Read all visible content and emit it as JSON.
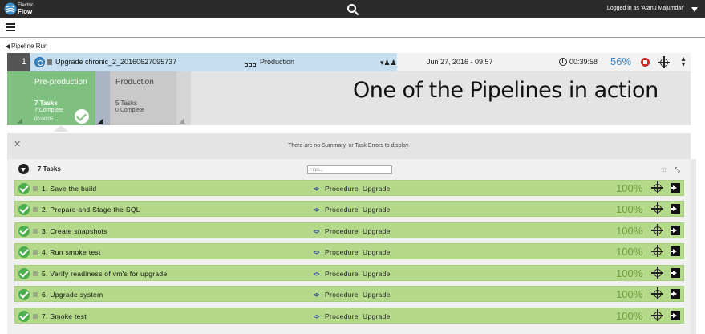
{
  "brand": {
    "line1": "Electric",
    "line2": "Flow",
    "logo_icon": "electricflow-logo-icon"
  },
  "header": {
    "search_icon": "search-icon",
    "login_text": "Logged in as 'Atanu Majumdar'"
  },
  "breadcrumb": {
    "label": "Pipeline Run"
  },
  "run": {
    "number": "1",
    "name": "Upgrade chronic_2_20160627095737",
    "environment": "Production",
    "date": "Jun 27, 2016 - 09:57",
    "elapsed": "00:39:58",
    "progress": "56%"
  },
  "stages": [
    {
      "name": "Pre-production",
      "tasks": "7 Tasks",
      "complete": "7 Complete",
      "time": "00:00:05",
      "status": "success"
    },
    {
      "name": "Production",
      "tasks": "5 Tasks",
      "complete": "0 Complete"
    }
  ],
  "annotation": "One of the Pipelines in action",
  "summary": {
    "message": "There are no Summary, or Task Errors to display."
  },
  "tasks_panel": {
    "count_label": "7 Tasks",
    "find_placeholder": "Find..."
  },
  "tasks": [
    {
      "name": "1. Save the build",
      "type": "Procedure",
      "procedure": "Upgrade",
      "progress": "100%"
    },
    {
      "name": "2. Prepare and Stage the SQL",
      "type": "Procedure",
      "procedure": "Upgrade",
      "progress": "100%"
    },
    {
      "name": "3. Create snapshots",
      "type": "Procedure",
      "procedure": "Upgrade",
      "progress": "100%"
    },
    {
      "name": "4. Run smoke test",
      "type": "Procedure",
      "procedure": "Upgrade",
      "progress": "100%"
    },
    {
      "name": "5. Verify readiness of vm's for upgrade",
      "type": "Procedure",
      "procedure": "Upgrade",
      "progress": "100%"
    },
    {
      "name": "6. Upgrade system",
      "type": "Procedure",
      "procedure": "Upgrade",
      "progress": "100%"
    },
    {
      "name": "7. Smoke test",
      "type": "Procedure",
      "procedure": "Upgrade",
      "progress": "100%"
    }
  ],
  "colors": {
    "topbar": "#2b2b2b",
    "run_header_blue": "#c6dff0",
    "stage_success": "#7fbf7f",
    "task_row": "#b5d98b",
    "progress_blue": "#3a85c4",
    "stop_red": "#d12a2a"
  }
}
